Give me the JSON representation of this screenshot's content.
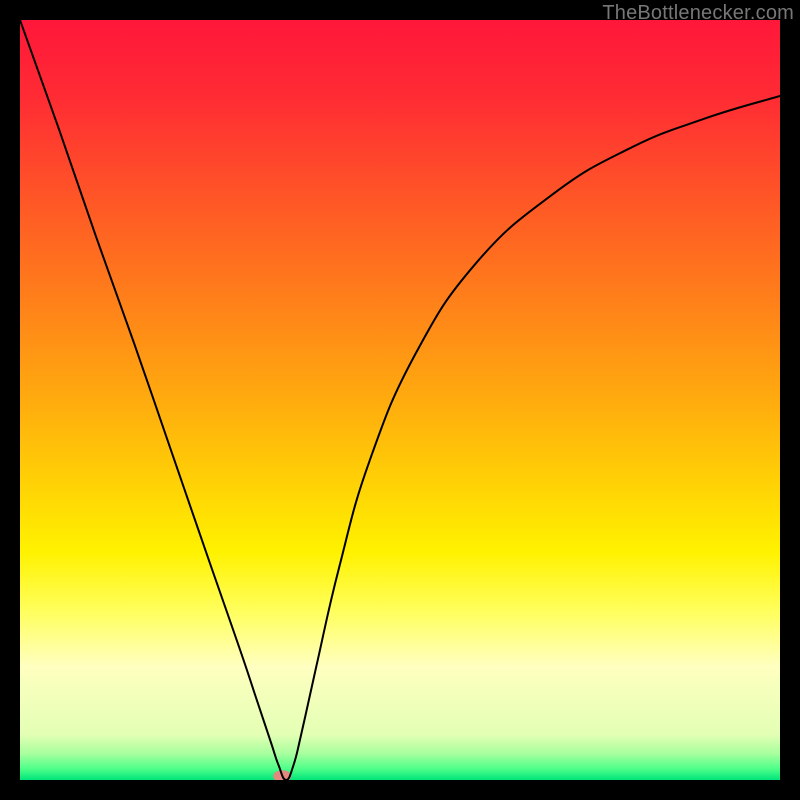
{
  "attribution": "TheBottlenecker.com",
  "chart_data": {
    "type": "line",
    "title": "",
    "xlabel": "",
    "ylabel": "",
    "xlim": [
      0,
      1
    ],
    "ylim": [
      0,
      1
    ],
    "background_gradient": {
      "stops": [
        {
          "pos": 0.0,
          "color": "#ff173a"
        },
        {
          "pos": 0.1,
          "color": "#ff2b34"
        },
        {
          "pos": 0.2,
          "color": "#ff4b2a"
        },
        {
          "pos": 0.3,
          "color": "#ff6a20"
        },
        {
          "pos": 0.4,
          "color": "#ff8a17"
        },
        {
          "pos": 0.5,
          "color": "#ffab0e"
        },
        {
          "pos": 0.6,
          "color": "#ffce06"
        },
        {
          "pos": 0.7,
          "color": "#fff200"
        },
        {
          "pos": 0.78,
          "color": "#ffff60"
        },
        {
          "pos": 0.85,
          "color": "#ffffc0"
        },
        {
          "pos": 0.94,
          "color": "#e3ffb4"
        },
        {
          "pos": 0.965,
          "color": "#a8ff9e"
        },
        {
          "pos": 0.985,
          "color": "#4fff8a"
        },
        {
          "pos": 1.0,
          "color": "#00e47a"
        }
      ]
    },
    "series": [
      {
        "name": "bottleneck-curve",
        "stroke": "#000000",
        "stroke_width": 2,
        "x": [
          0.0,
          0.05,
          0.1,
          0.15,
          0.2,
          0.25,
          0.29,
          0.31,
          0.33,
          0.34,
          0.35,
          0.36,
          0.37,
          0.39,
          0.42,
          0.46,
          0.52,
          0.6,
          0.7,
          0.8,
          0.9,
          1.0
        ],
        "y": [
          1.0,
          0.86,
          0.715,
          0.575,
          0.43,
          0.285,
          0.17,
          0.11,
          0.05,
          0.02,
          0.0,
          0.02,
          0.06,
          0.15,
          0.28,
          0.42,
          0.56,
          0.68,
          0.77,
          0.83,
          0.87,
          0.9
        ]
      }
    ],
    "marker": {
      "name": "optimal-point",
      "x": 0.345,
      "y": 0.005,
      "color": "#e4897f",
      "rx": 9,
      "ry": 6
    }
  }
}
